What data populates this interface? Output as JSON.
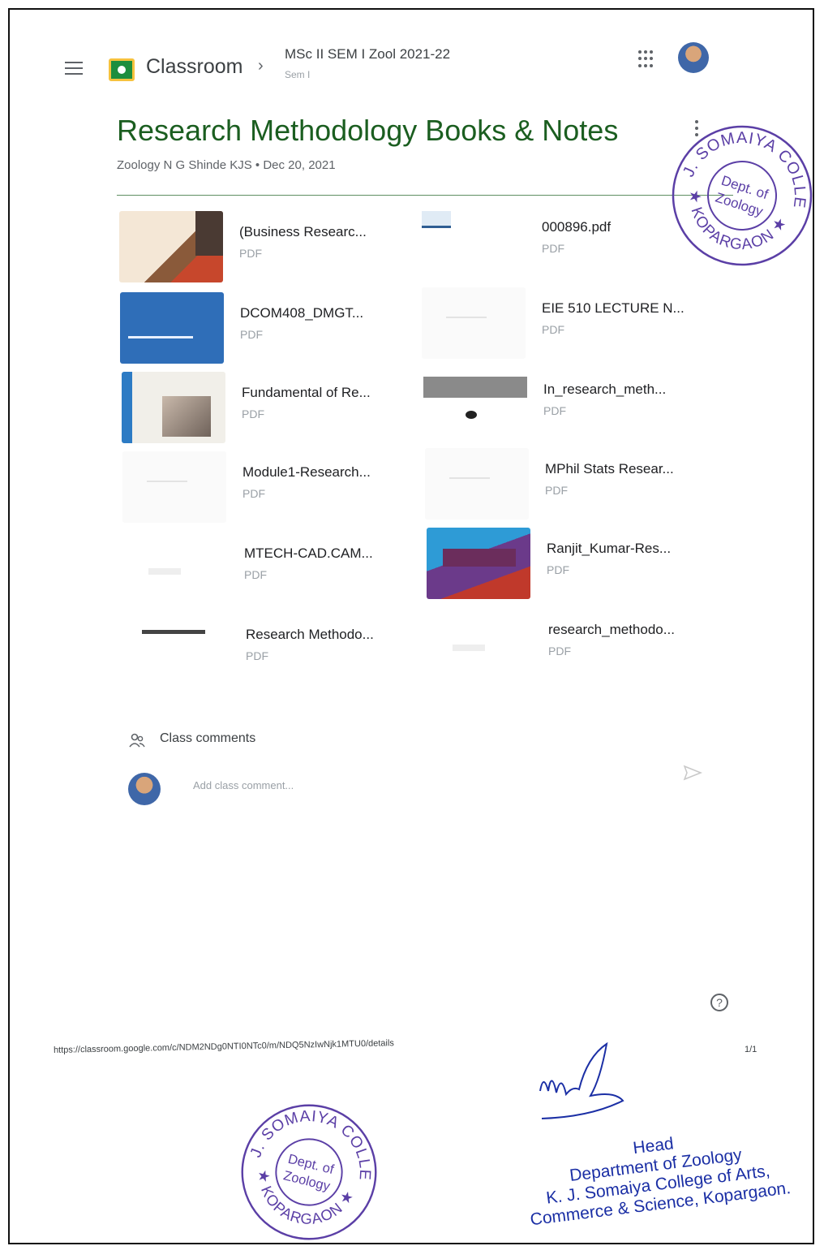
{
  "header": {
    "app_name": "Classroom",
    "course_name": "MSc II SEM I Zool 2021-22",
    "course_section": "Sem I"
  },
  "post": {
    "title": "Research Methodology Books & Notes",
    "meta": "Zoology N G Shinde KJS • Dec 20, 2021"
  },
  "attachments": [
    {
      "name": "(Business Researc...",
      "type": "PDF"
    },
    {
      "name": "000896.pdf",
      "type": "PDF"
    },
    {
      "name": "DCOM408_DMGT...",
      "type": "PDF"
    },
    {
      "name": "EIE 510 LECTURE N...",
      "type": "PDF"
    },
    {
      "name": "Fundamental of Re...",
      "type": "PDF"
    },
    {
      "name": "In_research_meth...",
      "type": "PDF"
    },
    {
      "name": "Module1-Research...",
      "type": "PDF"
    },
    {
      "name": "MPhil Stats Resear...",
      "type": "PDF"
    },
    {
      "name": "MTECH-CAD.CAM...",
      "type": "PDF"
    },
    {
      "name": "Ranjit_Kumar-Res...",
      "type": "PDF"
    },
    {
      "name": "Research Methodo...",
      "type": "PDF"
    },
    {
      "name": "research_methodo...",
      "type": "PDF"
    }
  ],
  "comments": {
    "label": "Class comments",
    "placeholder": "Add class comment..."
  },
  "print_footer": {
    "url": "https://classroom.google.com/c/NDM2NDg0NTI0NTc0/m/NDQ5NzIwNjk1MTU0/details",
    "page": "1/1"
  },
  "stamp": {
    "college": "K. J. SOMAIYA COLLEGE",
    "place": "KOPARGAON",
    "dept_line1": "Dept. of",
    "dept_line2": "Zoology"
  },
  "signature_block": {
    "line1": "Head",
    "line2": "Department of Zoology",
    "line3": "K. J. Somaiya College of Arts,",
    "line4": "Commerce & Science, Kopargaon."
  },
  "colors": {
    "title_green": "#1b5e20",
    "stamp_purple": "#5b3fa6",
    "ink_blue": "#1b2fa5"
  }
}
